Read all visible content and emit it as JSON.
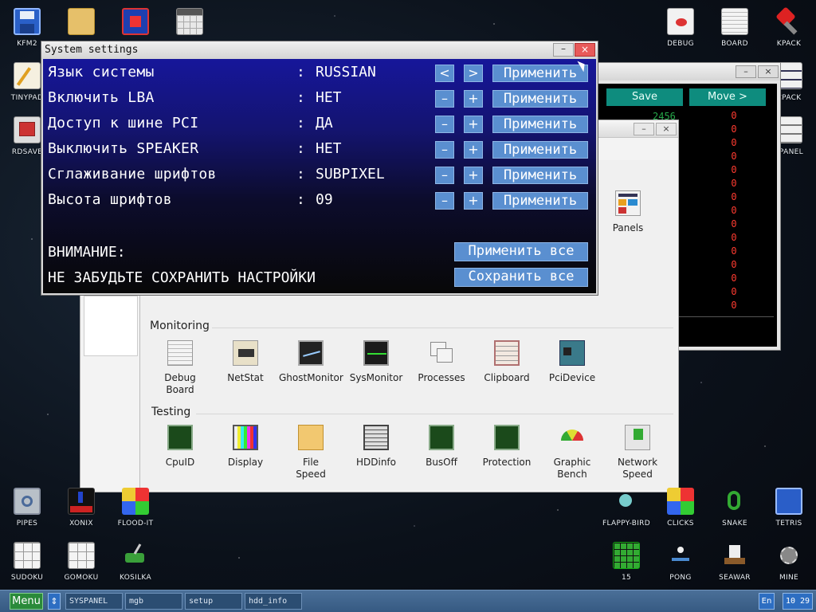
{
  "desktop": {
    "left_icons": [
      {
        "label": "KFM2",
        "icon": "floppy-icon"
      },
      {
        "label": "",
        "icon": "folder-icon"
      },
      {
        "label": "",
        "icon": "paint-icon"
      },
      {
        "label": "",
        "icon": "calculator-icon"
      },
      {
        "label": "TINYPAD",
        "icon": "notepad-icon"
      },
      {
        "label": "RDSAVE",
        "icon": "rdsave-icon"
      }
    ],
    "right_icons": [
      {
        "label": "DEBUG",
        "icon": "debug-icon"
      },
      {
        "label": "BOARD",
        "icon": "board-icon"
      },
      {
        "label": "KPACK",
        "icon": "kpack-icon"
      },
      {
        "label": "CPACK",
        "icon": "cpack-icon"
      },
      {
        "label": "SPANEL",
        "icon": "spanel-icon"
      }
    ],
    "games": [
      {
        "label": "PIPES"
      },
      {
        "label": "XONIX"
      },
      {
        "label": "FLOOD-IT"
      },
      {
        "label": "SUDOKU"
      },
      {
        "label": "GOMOKU"
      },
      {
        "label": "KOSILKA"
      },
      {
        "label": "FLAPPY-BIRD"
      },
      {
        "label": "CLICKS"
      },
      {
        "label": "SNAKE"
      },
      {
        "label": "TETRIS"
      },
      {
        "label": "15"
      },
      {
        "label": "PONG"
      },
      {
        "label": "SEAWAR"
      },
      {
        "label": "MINE"
      }
    ]
  },
  "board_window": {
    "save_label": "Save",
    "move_label": "Move >",
    "green_value": "2456",
    "red_values": [
      "0",
      "0",
      "0",
      "0",
      "0",
      "0",
      "0",
      "0",
      "0",
      "0",
      "0",
      "0",
      "0",
      "0",
      "0"
    ]
  },
  "setup_window": {
    "panels_label": "Panels",
    "monitoring_title": "Monitoring",
    "monitoring": [
      {
        "label": "Debug Board"
      },
      {
        "label": "NetStat"
      },
      {
        "label": "GhostMonitor"
      },
      {
        "label": "SysMonitor"
      },
      {
        "label": "Processes"
      },
      {
        "label": "Clipboard"
      },
      {
        "label": "PciDevice"
      }
    ],
    "testing_title": "Testing",
    "testing": [
      {
        "label": "CpuID"
      },
      {
        "label": "Display"
      },
      {
        "label": "File Speed"
      },
      {
        "label": "HDDinfo"
      },
      {
        "label": "BusOff"
      },
      {
        "label": "Protection"
      },
      {
        "label": "Graphic Bench"
      },
      {
        "label": "Network Speed"
      }
    ]
  },
  "system_settings": {
    "title": "System settings",
    "minimize": "–",
    "close": "×",
    "rows": [
      {
        "label": "Язык системы",
        "value": "RUSSIAN",
        "dec": "<",
        "inc": ">",
        "apply": "Применить"
      },
      {
        "label": "Включить LBA",
        "value": "НЕТ",
        "dec": "–",
        "inc": "+",
        "apply": "Применить"
      },
      {
        "label": "Доступ к шине PCI",
        "value": "ДА",
        "dec": "–",
        "inc": "+",
        "apply": "Применить"
      },
      {
        "label": "Выключить SPEAKER",
        "value": "НЕТ",
        "dec": "–",
        "inc": "+",
        "apply": "Применить"
      },
      {
        "label": "Сглаживание шрифтов",
        "value": "SUBPIXEL",
        "dec": "–",
        "inc": "+",
        "apply": "Применить"
      },
      {
        "label": "Высота шрифтов",
        "value": "09",
        "dec": "–",
        "inc": "+",
        "apply": "Применить"
      }
    ],
    "colon": ":",
    "warning_title": "ВНИМАНИЕ:",
    "warning_text": "НЕ ЗАБУДЬТЕ СОХРАНИТЬ НАСТРОЙКИ",
    "apply_all": "Применить все",
    "save_all": "Сохранить все"
  },
  "taskbar": {
    "menu": "Menu",
    "arrows": "⇕",
    "tasks": [
      {
        "label": "SYSPANEL"
      },
      {
        "label": "mgb"
      },
      {
        "label": "setup"
      },
      {
        "label": "hdd_info"
      }
    ],
    "lang": "En",
    "clock": "10 29"
  }
}
